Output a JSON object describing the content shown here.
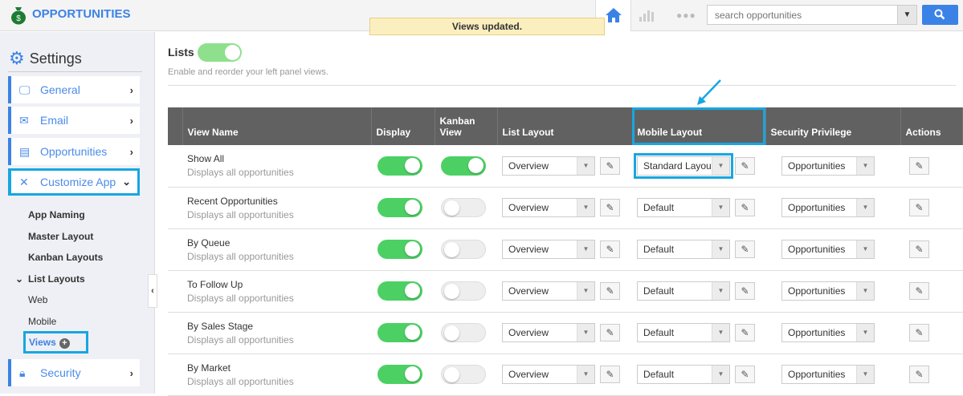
{
  "header": {
    "app_title": "OPPORTUNITIES",
    "search_placeholder": "search opportunities"
  },
  "toast": "Views updated.",
  "sidebar": {
    "title": "Settings",
    "items": [
      {
        "label": "General",
        "icon": "monitor-icon"
      },
      {
        "label": "Email",
        "icon": "envelope-icon"
      },
      {
        "label": "Opportunities",
        "icon": "window-icon"
      },
      {
        "label": "Customize App",
        "icon": "tools-icon"
      },
      {
        "label": "Security",
        "icon": "lock-icon"
      }
    ],
    "sub_items": [
      "App Naming",
      "Master Layout",
      "Kanban Layouts",
      "List Layouts"
    ],
    "list_layouts_children": [
      "Web",
      "Mobile",
      "Views"
    ]
  },
  "main": {
    "title": "Lists",
    "lists_enabled": true,
    "description": "Enable and reorder your left panel views.",
    "columns": [
      "View Name",
      "Display",
      "Kanban View",
      "List Layout",
      "Mobile Layout",
      "Security Privilege",
      "Actions"
    ],
    "rows": [
      {
        "name": "Show All",
        "desc": "Displays all opportunities",
        "display": true,
        "kanban": true,
        "list_layout": "Overview",
        "mobile_layout": "Standard Layout",
        "security": "Opportunities"
      },
      {
        "name": "Recent Opportunities",
        "desc": "Displays all opportunities",
        "display": true,
        "kanban": false,
        "list_layout": "Overview",
        "mobile_layout": "Default",
        "security": "Opportunities"
      },
      {
        "name": "By Queue",
        "desc": "Displays all opportunities",
        "display": true,
        "kanban": false,
        "list_layout": "Overview",
        "mobile_layout": "Default",
        "security": "Opportunities"
      },
      {
        "name": "To Follow Up",
        "desc": "Displays all opportunities",
        "display": true,
        "kanban": false,
        "list_layout": "Overview",
        "mobile_layout": "Default",
        "security": "Opportunities"
      },
      {
        "name": "By Sales Stage",
        "desc": "Displays all opportunities",
        "display": true,
        "kanban": false,
        "list_layout": "Overview",
        "mobile_layout": "Default",
        "security": "Opportunities"
      },
      {
        "name": "By Market",
        "desc": "Displays all opportunities",
        "display": true,
        "kanban": false,
        "list_layout": "Overview",
        "mobile_layout": "Default",
        "security": "Opportunities"
      }
    ]
  },
  "colors": {
    "accent": "#3b82e6",
    "highlight": "#18a6e0",
    "toggle_on": "#4cd064",
    "header_bg": "#616161"
  }
}
